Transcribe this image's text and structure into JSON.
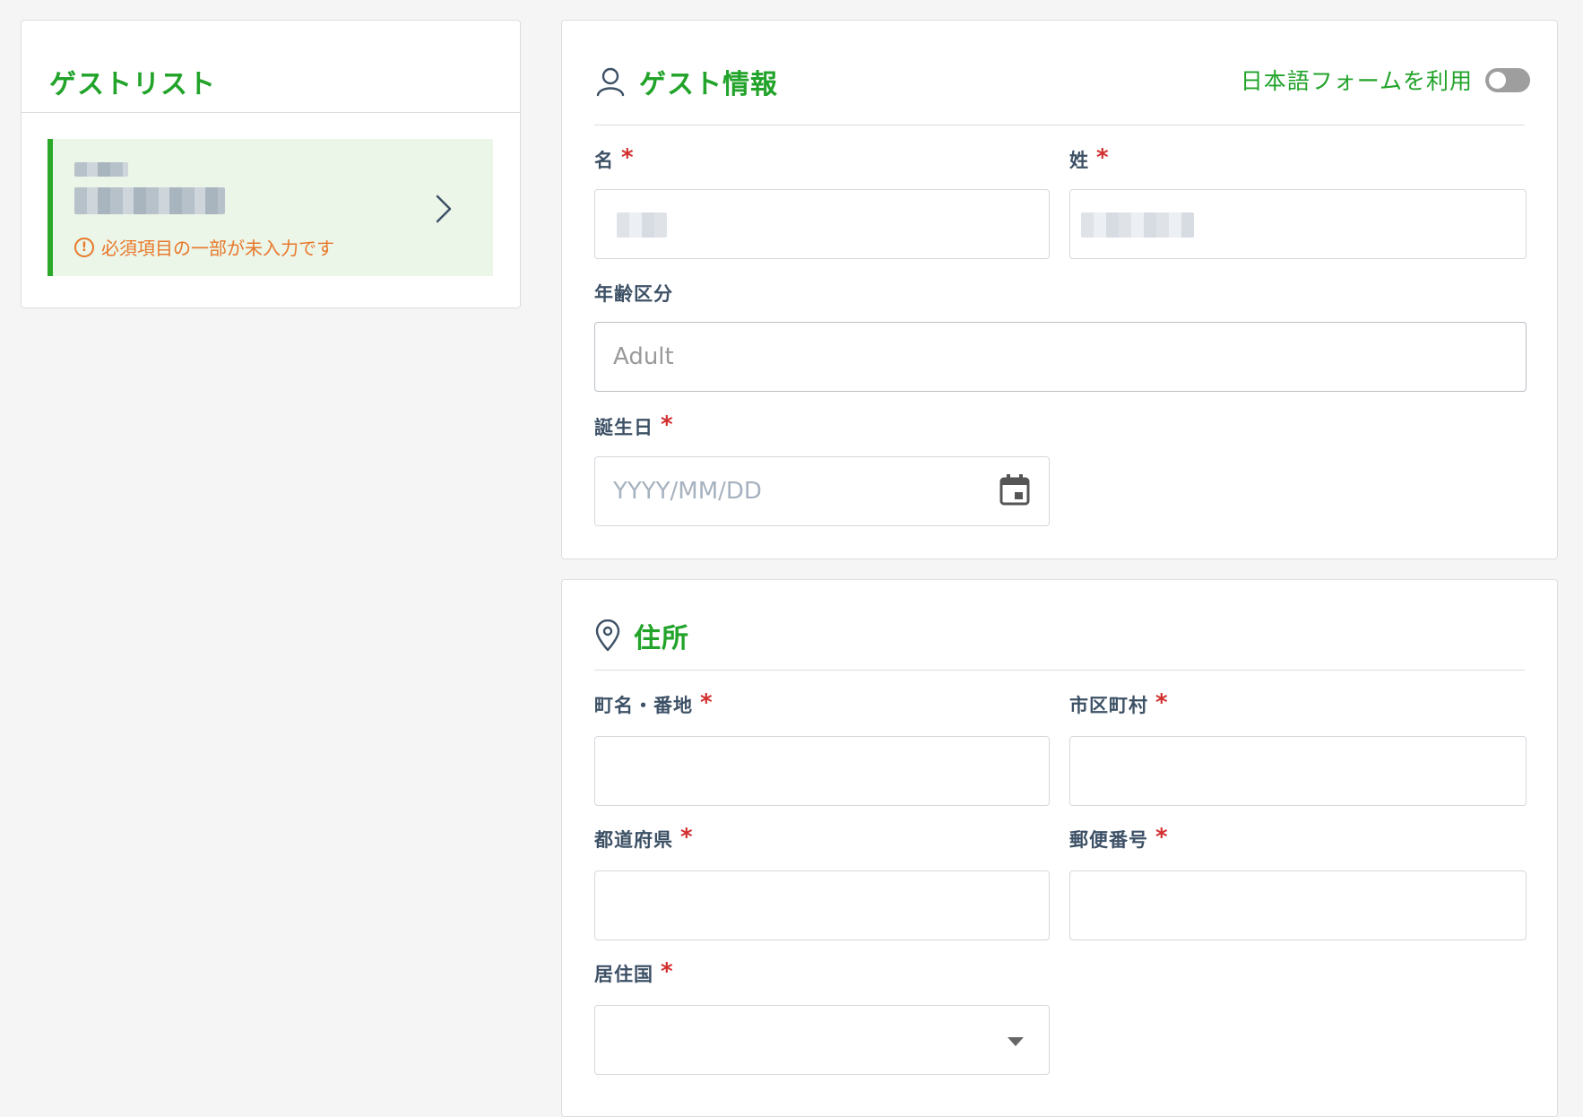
{
  "guest_list": {
    "title": "ゲストリスト",
    "items": [
      {
        "warning": "必須項目の一部が未入力です"
      }
    ]
  },
  "guest_info": {
    "title": "ゲスト情報",
    "toggle_label": "日本語フォームを利用",
    "first_name_label": "名",
    "last_name_label": "姓",
    "age_group_label": "年齢区分",
    "age_group_value": "Adult",
    "birthday_label": "誕生日",
    "birthday_placeholder": "YYYY/MM/DD",
    "required_mark": "*"
  },
  "address": {
    "title": "住所",
    "street_label": "町名・番地",
    "city_label": "市区町村",
    "prefecture_label": "都道府県",
    "postal_label": "郵便番号",
    "country_label": "居住国",
    "required_mark": "*"
  },
  "colors": {
    "accent_green": "#22a32a",
    "warning_orange": "#e8782a",
    "required_red": "#d32f2f",
    "item_bg": "#ebf5e8"
  }
}
